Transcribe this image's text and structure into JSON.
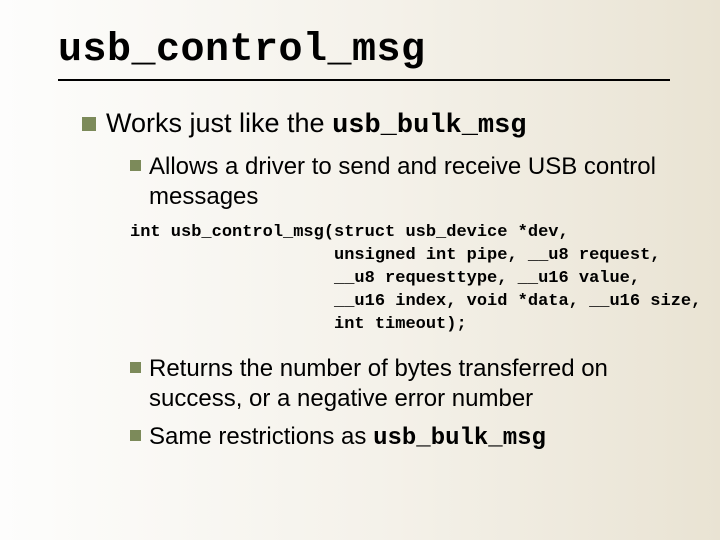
{
  "title": "usb_control_msg",
  "lvl1": {
    "pre": "Works just like the ",
    "code": "usb_bulk_msg"
  },
  "lvl2a": "Allows a driver to send and receive USB control messages",
  "code_lines": [
    "int usb_control_msg(struct usb_device *dev,",
    "                    unsigned int pipe, __u8 request,",
    "                    __u8 requesttype, __u16 value,",
    "                    __u16 index, void *data, __u16 size,",
    "                    int timeout);"
  ],
  "lvl2b": "Returns the number of bytes transferred on success, or a negative error number",
  "lvl2c": {
    "pre": "Same restrictions as ",
    "code": "usb_bulk_msg"
  }
}
